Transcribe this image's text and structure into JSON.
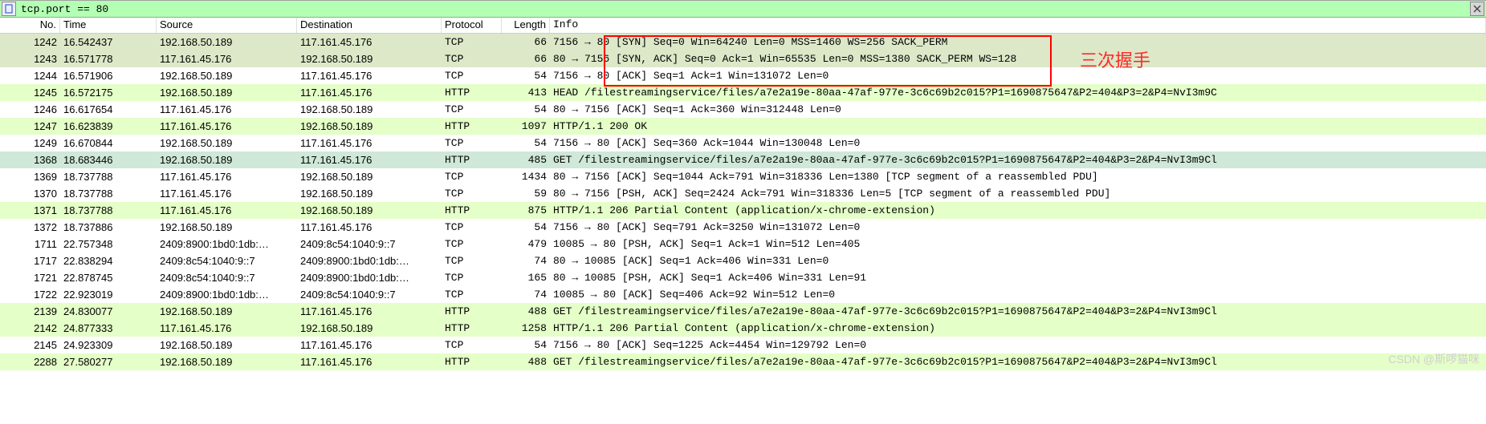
{
  "filter": {
    "value": "tcp.port == 80"
  },
  "headers": {
    "no": "No.",
    "time": "Time",
    "src": "Source",
    "dst": "Destination",
    "proto": "Protocol",
    "len": "Length",
    "info": "Info"
  },
  "annotation": {
    "label": "三次握手"
  },
  "watermark": "CSDN @斯啰猫咪",
  "rows": [
    {
      "no": "1242",
      "time": "16.542437",
      "src": "192.168.50.189",
      "dst": "117.161.45.176",
      "proto": "TCP",
      "len": "66",
      "info": "7156 → 80 [SYN] Seq=0 Win=64240 Len=0 MSS=1460 WS=256 SACK_PERM",
      "cls": "bg-syn"
    },
    {
      "no": "1243",
      "time": "16.571778",
      "src": "117.161.45.176",
      "dst": "192.168.50.189",
      "proto": "TCP",
      "len": "66",
      "info": "80 → 7156 [SYN, ACK] Seq=0 Ack=1 Win=65535 Len=0 MSS=1380 SACK_PERM WS=128",
      "cls": "bg-syn"
    },
    {
      "no": "1244",
      "time": "16.571906",
      "src": "192.168.50.189",
      "dst": "117.161.45.176",
      "proto": "TCP",
      "len": "54",
      "info": "7156 → 80 [ACK] Seq=1 Ack=1 Win=131072 Len=0",
      "cls": "bg-plain"
    },
    {
      "no": "1245",
      "time": "16.572175",
      "src": "192.168.50.189",
      "dst": "117.161.45.176",
      "proto": "HTTP",
      "len": "413",
      "info": "HEAD /filestreamingservice/files/a7e2a19e-80aa-47af-977e-3c6c69b2c015?P1=1690875647&P2=404&P3=2&P4=NvI3m9C",
      "cls": "bg-http"
    },
    {
      "no": "1246",
      "time": "16.617654",
      "src": "117.161.45.176",
      "dst": "192.168.50.189",
      "proto": "TCP",
      "len": "54",
      "info": "80 → 7156 [ACK] Seq=1 Ack=360 Win=312448 Len=0",
      "cls": "bg-plain"
    },
    {
      "no": "1247",
      "time": "16.623839",
      "src": "117.161.45.176",
      "dst": "192.168.50.189",
      "proto": "HTTP",
      "len": "1097",
      "info": "HTTP/1.1 200 OK",
      "cls": "bg-http"
    },
    {
      "no": "1249",
      "time": "16.670844",
      "src": "192.168.50.189",
      "dst": "117.161.45.176",
      "proto": "TCP",
      "len": "54",
      "info": "7156 → 80 [ACK] Seq=360 Ack=1044 Win=130048 Len=0",
      "cls": "bg-plain"
    },
    {
      "no": "1368",
      "time": "18.683446",
      "src": "192.168.50.189",
      "dst": "117.161.45.176",
      "proto": "HTTP",
      "len": "485",
      "info": "GET /filestreamingservice/files/a7e2a19e-80aa-47af-977e-3c6c69b2c015?P1=1690875647&P2=404&P3=2&P4=NvI3m9Cl",
      "cls": "bg-sel"
    },
    {
      "no": "1369",
      "time": "18.737788",
      "src": "117.161.45.176",
      "dst": "192.168.50.189",
      "proto": "TCP",
      "len": "1434",
      "info": "80 → 7156 [ACK] Seq=1044 Ack=791 Win=318336 Len=1380 [TCP segment of a reassembled PDU]",
      "cls": "bg-plain"
    },
    {
      "no": "1370",
      "time": "18.737788",
      "src": "117.161.45.176",
      "dst": "192.168.50.189",
      "proto": "TCP",
      "len": "59",
      "info": "80 → 7156 [PSH, ACK] Seq=2424 Ack=791 Win=318336 Len=5 [TCP segment of a reassembled PDU]",
      "cls": "bg-plain"
    },
    {
      "no": "1371",
      "time": "18.737788",
      "src": "117.161.45.176",
      "dst": "192.168.50.189",
      "proto": "HTTP",
      "len": "875",
      "info": "HTTP/1.1 206 Partial Content  (application/x-chrome-extension)",
      "cls": "bg-http"
    },
    {
      "no": "1372",
      "time": "18.737886",
      "src": "192.168.50.189",
      "dst": "117.161.45.176",
      "proto": "TCP",
      "len": "54",
      "info": "7156 → 80 [ACK] Seq=791 Ack=3250 Win=131072 Len=0",
      "cls": "bg-plain"
    },
    {
      "no": "1711",
      "time": "22.757348",
      "src": "2409:8900:1bd0:1db:…",
      "dst": "2409:8c54:1040:9::7",
      "proto": "TCP",
      "len": "479",
      "info": "10085 → 80 [PSH, ACK] Seq=1 Ack=1 Win=512 Len=405",
      "cls": "bg-plain"
    },
    {
      "no": "1717",
      "time": "22.838294",
      "src": "2409:8c54:1040:9::7",
      "dst": "2409:8900:1bd0:1db:…",
      "proto": "TCP",
      "len": "74",
      "info": "80 → 10085 [ACK] Seq=1 Ack=406 Win=331 Len=0",
      "cls": "bg-plain"
    },
    {
      "no": "1721",
      "time": "22.878745",
      "src": "2409:8c54:1040:9::7",
      "dst": "2409:8900:1bd0:1db:…",
      "proto": "TCP",
      "len": "165",
      "info": "80 → 10085 [PSH, ACK] Seq=1 Ack=406 Win=331 Len=91",
      "cls": "bg-plain"
    },
    {
      "no": "1722",
      "time": "22.923019",
      "src": "2409:8900:1bd0:1db:…",
      "dst": "2409:8c54:1040:9::7",
      "proto": "TCP",
      "len": "74",
      "info": "10085 → 80 [ACK] Seq=406 Ack=92 Win=512 Len=0",
      "cls": "bg-plain"
    },
    {
      "no": "2139",
      "time": "24.830077",
      "src": "192.168.50.189",
      "dst": "117.161.45.176",
      "proto": "HTTP",
      "len": "488",
      "info": "GET /filestreamingservice/files/a7e2a19e-80aa-47af-977e-3c6c69b2c015?P1=1690875647&P2=404&P3=2&P4=NvI3m9Cl",
      "cls": "bg-http"
    },
    {
      "no": "2142",
      "time": "24.877333",
      "src": "117.161.45.176",
      "dst": "192.168.50.189",
      "proto": "HTTP",
      "len": "1258",
      "info": "HTTP/1.1 206 Partial Content  (application/x-chrome-extension)",
      "cls": "bg-http"
    },
    {
      "no": "2145",
      "time": "24.923309",
      "src": "192.168.50.189",
      "dst": "117.161.45.176",
      "proto": "TCP",
      "len": "54",
      "info": "7156 → 80 [ACK] Seq=1225 Ack=4454 Win=129792 Len=0",
      "cls": "bg-plain"
    },
    {
      "no": "2288",
      "time": "27.580277",
      "src": "192.168.50.189",
      "dst": "117.161.45.176",
      "proto": "HTTP",
      "len": "488",
      "info": "GET /filestreamingservice/files/a7e2a19e-80aa-47af-977e-3c6c69b2c015?P1=1690875647&P2=404&P3=2&P4=NvI3m9Cl",
      "cls": "bg-http"
    }
  ]
}
